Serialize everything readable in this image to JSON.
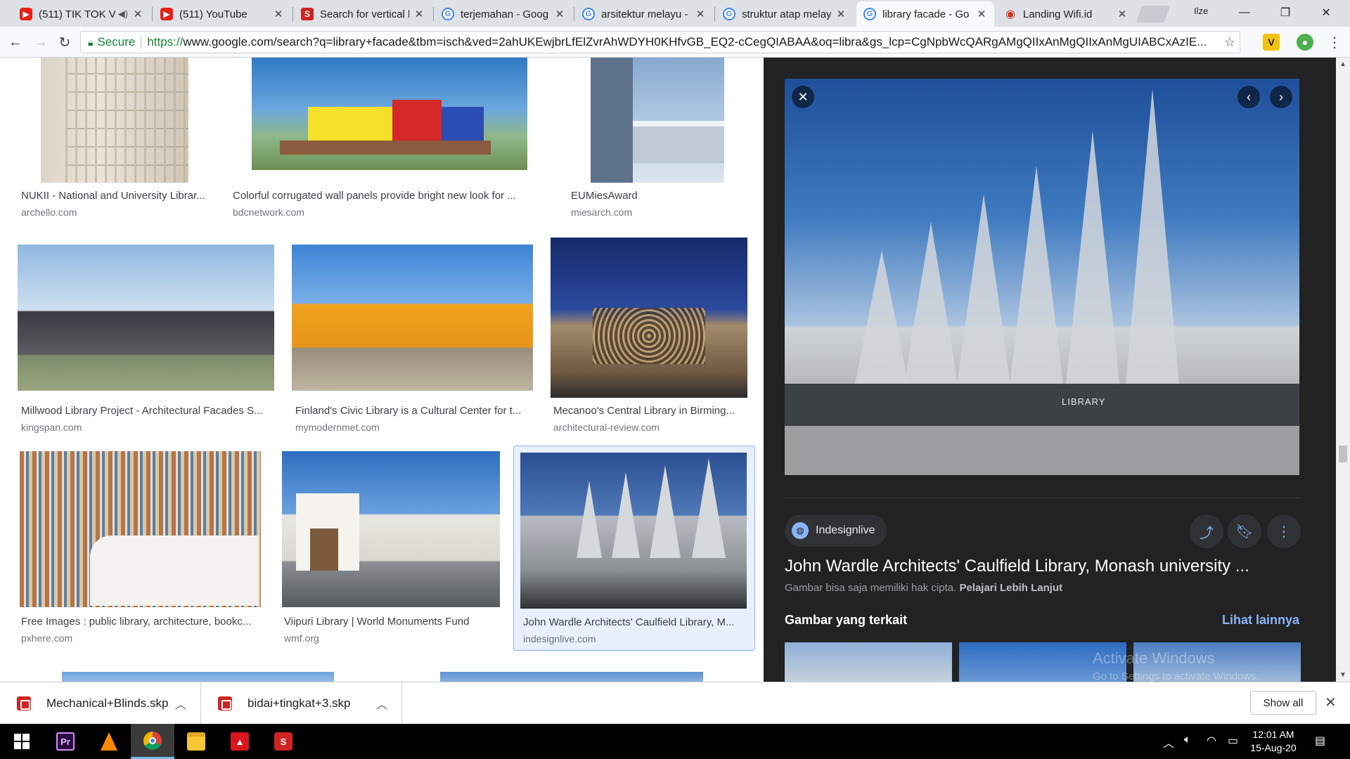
{
  "browser": {
    "tabs": [
      {
        "title": "(511) TIK TOK V",
        "icon": "youtube-icon",
        "audio": true
      },
      {
        "title": "(511) YouTube",
        "icon": "youtube-icon"
      },
      {
        "title": "Search for vertical l",
        "icon": "sketchup-icon"
      },
      {
        "title": "terjemahan - Goog",
        "icon": "google-icon"
      },
      {
        "title": "arsitektur melayu -",
        "icon": "google-icon"
      },
      {
        "title": "struktur atap melay",
        "icon": "google-icon"
      },
      {
        "title": "library facade - Go",
        "icon": "google-icon",
        "active": true
      },
      {
        "title": "Landing Wifi.id",
        "icon": "wifi-icon"
      }
    ],
    "profile_label": "Ilze",
    "address": {
      "secure_label": "Secure",
      "url_scheme": "https://",
      "url_rest": "www.google.com/search?q=library+facade&tbm=isch&ved=2ahUKEwjbrLfElZvrAhWDYH0KHfvGB_EQ2-cCegQIABAA&oq=libra&gs_lcp=CgNpbWcQARgAMgQIIxAnMgQIIxAnMgUIABCxAzIE..."
    }
  },
  "results": [
    {
      "caption": "NUKII - National and University Librar...",
      "source": "archello.com"
    },
    {
      "caption": "Colorful corrugated wall panels provide bright new look for ...",
      "source": "bdcnetwork.com"
    },
    {
      "caption": "EUMiesAward",
      "source": "miesarch.com"
    },
    {
      "caption": "Millwood Library Project - Architectural Facades S...",
      "source": "kingspan.com"
    },
    {
      "caption": "Finland's Civic Library is a Cultural Center for t...",
      "source": "mymodernmet.com"
    },
    {
      "caption": "Mecanoo's Central Library in Birming...",
      "source": "architectural-review.com"
    },
    {
      "caption": "Free Images : public library, architecture, bookc...",
      "source": "pxhere.com"
    },
    {
      "caption": "Viipuri Library | World Monuments Fund",
      "source": "wmf.org"
    },
    {
      "caption": "John Wardle Architects' Caulfield Library, M...",
      "source": "indesignlive.com"
    }
  ],
  "panel": {
    "source_name": "Indesignlive",
    "title": "John Wardle Architects' Caulfield Library, Monash university ...",
    "rights_text": "Gambar bisa saja memiliki hak cipta.",
    "rights_link": "Pelajari Lebih Lanjut",
    "related_heading": "Gambar yang terkait",
    "more_link": "Lihat lainnya",
    "building_sign": "LIBRARY",
    "watermark_title": "Activate Windows",
    "watermark_sub": "Go to Settings to activate Windows."
  },
  "downloads": {
    "items": [
      {
        "name": "Mechanical+Blinds.skp"
      },
      {
        "name": "bidai+tingkat+3.skp"
      }
    ],
    "show_all": "Show all"
  },
  "taskbar": {
    "apps": [
      "windows-start-icon",
      "premiere-pro-icon",
      "vlc-icon",
      "chrome-icon",
      "file-explorer-icon",
      "acrobat-icon",
      "sketchup-icon"
    ],
    "premiere_label": "Pr",
    "time": "12:01 AM",
    "date": "15-Aug-20"
  },
  "colors": {
    "panel_bg": "#222222",
    "link_blue": "#8ab4f8",
    "secure_green": "#188038",
    "selection_bg": "#e8f0fe"
  }
}
